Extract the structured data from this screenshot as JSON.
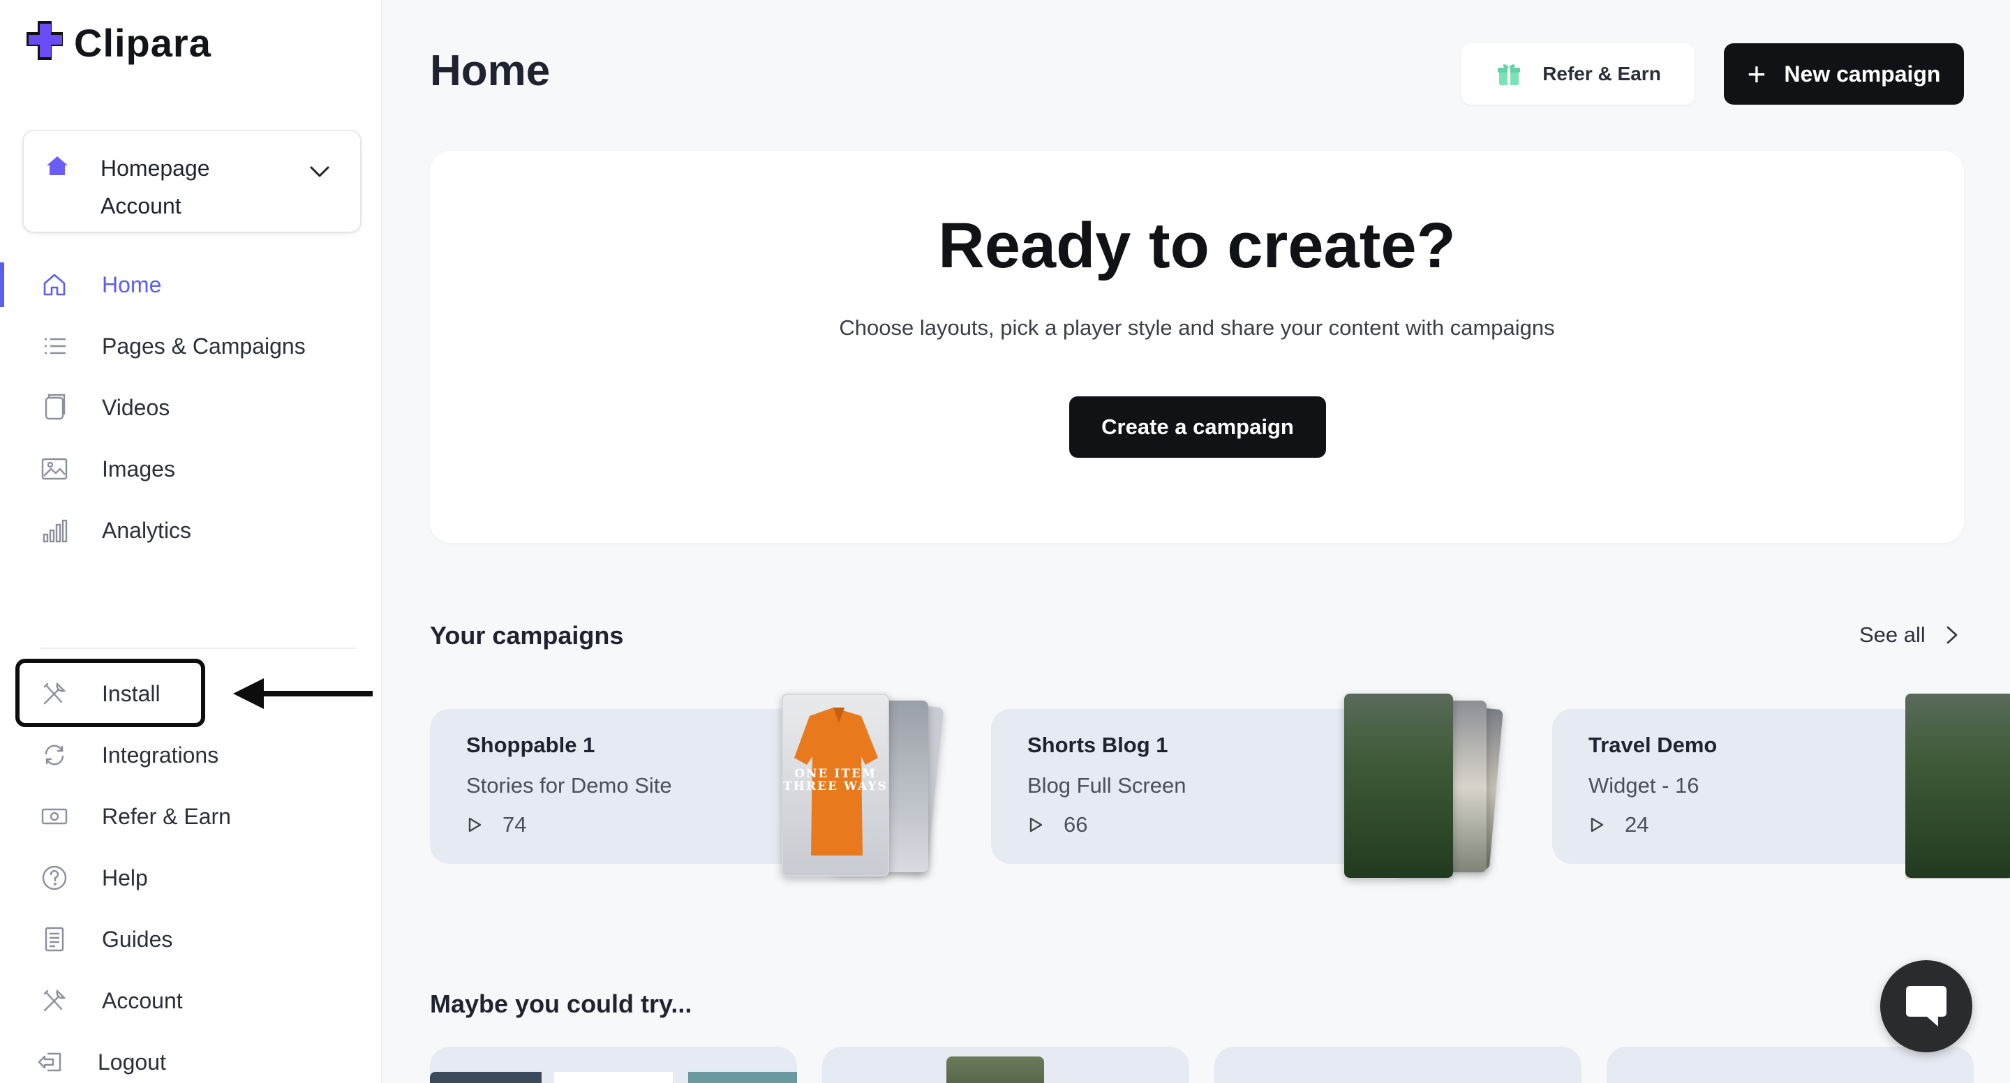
{
  "brand": {
    "name": "Clipara",
    "accent": "#5b5ff0",
    "logo_color": "#6a4cf5"
  },
  "account": {
    "name": "Homepage Account"
  },
  "nav_primary": [
    {
      "label": "Home",
      "icon": "home-icon",
      "active": true
    },
    {
      "label": "Pages & Campaigns",
      "icon": "list-icon"
    },
    {
      "label": "Videos",
      "icon": "video-file-icon"
    },
    {
      "label": "Images",
      "icon": "image-icon"
    },
    {
      "label": "Analytics",
      "icon": "bar-chart-icon"
    }
  ],
  "nav_secondary": [
    {
      "label": "Install",
      "icon": "tools-icon"
    },
    {
      "label": "Integrations",
      "icon": "refresh-icon"
    },
    {
      "label": "Refer & Earn",
      "icon": "money-icon"
    },
    {
      "label": "Help",
      "icon": "help-circle-icon"
    },
    {
      "label": "Guides",
      "icon": "document-icon"
    },
    {
      "label": "Account",
      "icon": "tools-icon"
    },
    {
      "label": "Logout",
      "icon": "logout-icon"
    }
  ],
  "header": {
    "title": "Home",
    "refer_label": "Refer & Earn",
    "new_campaign_label": "New campaign"
  },
  "hero": {
    "title": "Ready to create?",
    "subtitle": "Choose layouts, pick a player style and share your content with campaigns",
    "button_label": "Create a campaign"
  },
  "campaigns_section": {
    "title": "Your campaigns",
    "see_all_label": "See all",
    "items": [
      {
        "title": "Shoppable 1",
        "subtitle": "Stories for Demo Site",
        "views": "74",
        "thumb_text": "ONE ITEM THREE WAYS"
      },
      {
        "title": "Shorts Blog 1",
        "subtitle": "Blog Full Screen",
        "views": "66"
      },
      {
        "title": "Travel Demo",
        "subtitle": "Widget - 16",
        "views": "24"
      }
    ]
  },
  "try_section": {
    "title": "Maybe you could try..."
  },
  "annotation": {
    "highlighted_item": "Install"
  }
}
